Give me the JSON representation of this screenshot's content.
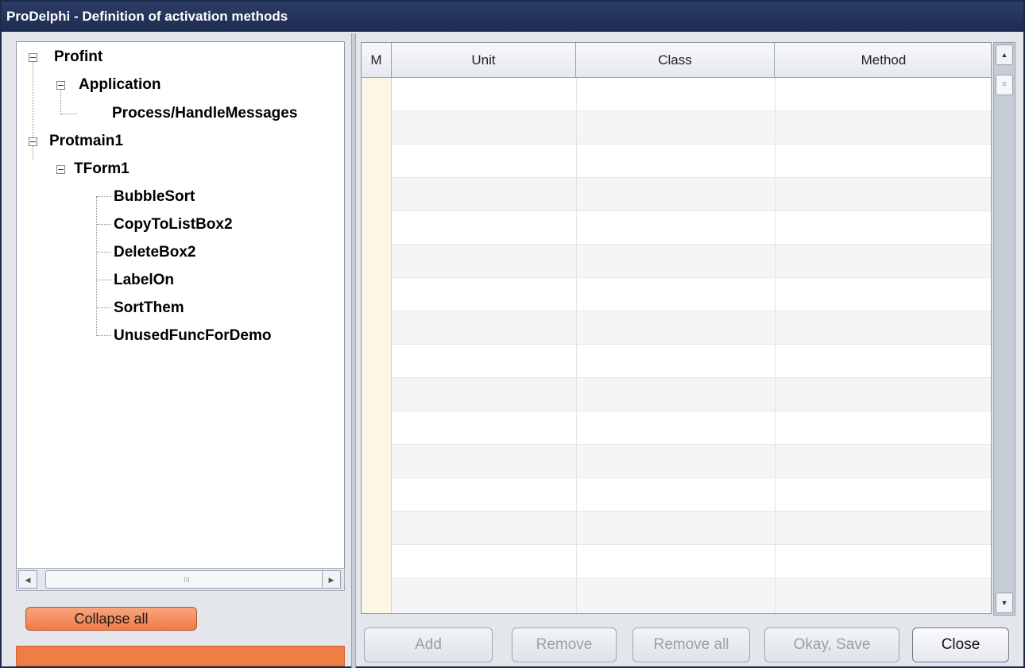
{
  "window": {
    "title": "ProDelphi - Definition of activation methods"
  },
  "tree": {
    "nodes": [
      {
        "label": "Profint",
        "level": 0,
        "expanded": true
      },
      {
        "label": "Application",
        "level": 1,
        "expanded": true
      },
      {
        "label": "Process/HandleMessages",
        "level": 2
      },
      {
        "label": "Protmain1",
        "level": 0,
        "expanded": true
      },
      {
        "label": "TForm1",
        "level": 1,
        "expanded": true
      },
      {
        "label": "BubbleSort",
        "level": 2
      },
      {
        "label": "CopyToListBox2",
        "level": 2
      },
      {
        "label": "DeleteBox2",
        "level": 2
      },
      {
        "label": "LabelOn",
        "level": 2
      },
      {
        "label": "SortThem",
        "level": 2
      },
      {
        "label": "UnusedFuncForDemo",
        "level": 2
      }
    ]
  },
  "left_panel": {
    "collapse_label": "Collapse all"
  },
  "grid": {
    "columns": [
      "M",
      "Unit",
      "Class",
      "Method"
    ],
    "rows": []
  },
  "buttons": {
    "add": "Add",
    "remove": "Remove",
    "remove_all": "Remove all",
    "okay_save": "Okay, Save",
    "close": "Close"
  },
  "icons": {
    "tree_expander": "minus-box-icon",
    "scroll_left": "arrow-left-icon",
    "scroll_right": "arrow-right-icon",
    "scroll_up": "arrow-up-icon",
    "scroll_down": "arrow-down-icon"
  },
  "colors": {
    "titlebar": "#1d2b4f",
    "accent_orange": "#ef7d44"
  }
}
